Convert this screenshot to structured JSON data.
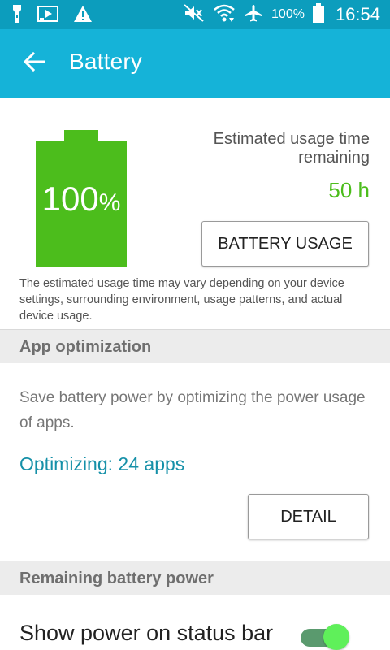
{
  "status_bar": {
    "battery_text": "100%",
    "time": "16:54",
    "icons": [
      "torch-icon",
      "media-play-icon",
      "warning-icon",
      "mute-icon",
      "wifi-icon",
      "airplane-icon",
      "battery-icon"
    ]
  },
  "app_bar": {
    "title": "Battery",
    "back_icon": "back-arrow-icon"
  },
  "battery": {
    "level_percent": 100,
    "percent_number": "100",
    "percent_sign": "%",
    "estimated_label": "Estimated usage time remaining",
    "estimated_value": "50 h",
    "usage_button_label": "BATTERY USAGE",
    "disclaimer": "The estimated usage time may vary depending on your device settings, surrounding environment, usage patterns, and actual device usage.",
    "color": "#4cbd1c"
  },
  "app_optimization": {
    "header": "App optimization",
    "description": "Save battery power by optimizing the power usage of apps.",
    "status": "Optimizing: 24 apps",
    "detail_button_label": "DETAIL"
  },
  "remaining_power": {
    "header": "Remaining battery power",
    "show_power_label": "Show power on status bar",
    "show_power_enabled": true
  },
  "colors": {
    "status_bar": "#0c9dbd",
    "app_bar": "#15b3d8",
    "accent_teal": "#1590a8",
    "toggle_on": "#5ff05a"
  }
}
